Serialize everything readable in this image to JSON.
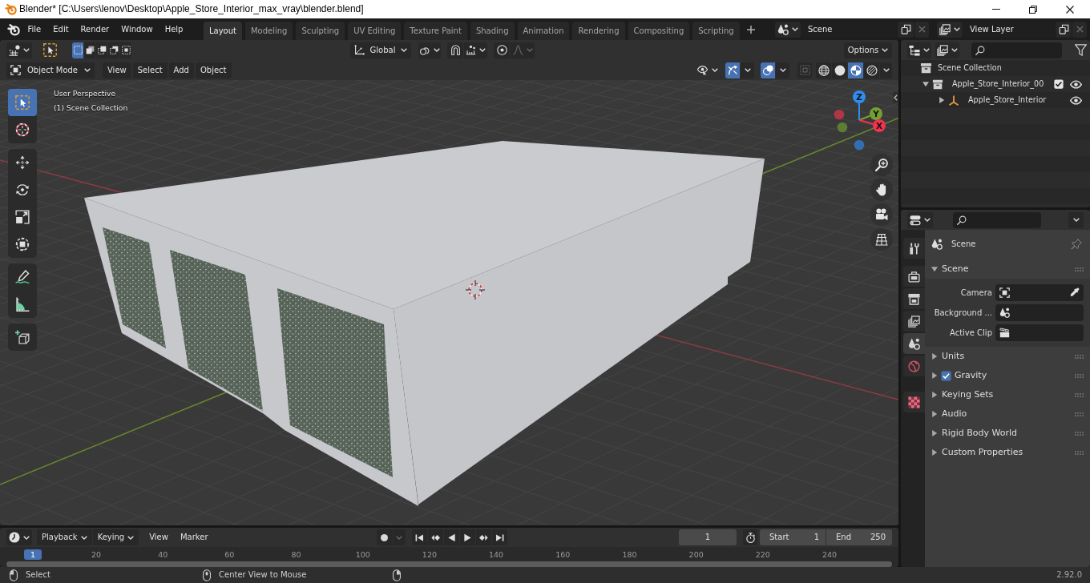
{
  "window": {
    "title": "Blender* [C:\\Users\\lenov\\Desktop\\Apple_Store_Interior_max_vray\\blender.blend]"
  },
  "top_bar": {
    "menus": [
      "File",
      "Edit",
      "Render",
      "Window",
      "Help"
    ],
    "workspaces": [
      {
        "label": "Layout",
        "selected": true
      },
      {
        "label": "Modeling",
        "selected": false
      },
      {
        "label": "Sculpting",
        "selected": false
      },
      {
        "label": "UV Editing",
        "selected": false
      },
      {
        "label": "Texture Paint",
        "selected": false
      },
      {
        "label": "Shading",
        "selected": false
      },
      {
        "label": "Animation",
        "selected": false
      },
      {
        "label": "Rendering",
        "selected": false
      },
      {
        "label": "Compositing",
        "selected": false
      },
      {
        "label": "Scripting",
        "selected": false
      }
    ],
    "scene": "Scene",
    "view_layer": "View Layer"
  },
  "tool_header": {
    "select_modes": [
      {
        "kind": "set",
        "selected": true
      },
      {
        "kind": "extend",
        "selected": false
      },
      {
        "kind": "subtract",
        "selected": false
      },
      {
        "kind": "invert",
        "selected": false
      },
      {
        "kind": "intersect",
        "selected": false
      }
    ],
    "orientation": "Global",
    "snap": {
      "on": false
    },
    "proportional": {
      "on": false
    },
    "options": "Options"
  },
  "viewport_header": {
    "mode": "Object Mode",
    "menus": [
      "View",
      "Select",
      "Add",
      "Object"
    ],
    "gizmos": {
      "on": true
    },
    "overlays": {
      "on": true
    },
    "xray": {
      "on": false
    },
    "shading": [
      {
        "kind": "wireframe",
        "selected": false
      },
      {
        "kind": "solid",
        "selected": false
      },
      {
        "kind": "material",
        "selected": true
      },
      {
        "kind": "rendered",
        "selected": false
      }
    ]
  },
  "viewport": {
    "info": [
      "User Perspective",
      "(1) Scene Collection"
    ],
    "tool_groups": [
      [
        {
          "kind": "select",
          "selected": true
        },
        {
          "kind": "cursor",
          "selected": false
        }
      ],
      [
        {
          "kind": "move",
          "selected": false
        },
        {
          "kind": "rotate",
          "selected": false
        },
        {
          "kind": "scale",
          "selected": false
        },
        {
          "kind": "transform",
          "selected": false
        }
      ],
      [
        {
          "kind": "annotate",
          "selected": false
        },
        {
          "kind": "measure",
          "selected": false
        }
      ],
      [
        {
          "kind": "add",
          "selected": false
        }
      ]
    ],
    "axes": [
      {
        "label": "Z",
        "color": "#2f8cf0"
      },
      {
        "label": "Y",
        "color": "#74a032"
      },
      {
        "label": "X",
        "color": "#f0334e"
      }
    ]
  },
  "timeline": {
    "menus": [
      {
        "label": "Playback",
        "kind": "dropdown"
      },
      {
        "label": "Keying",
        "kind": "dropdown"
      },
      {
        "label": "View",
        "kind": "menu"
      },
      {
        "label": "Marker",
        "kind": "menu"
      }
    ],
    "auto_keying": {
      "on": false
    },
    "current_frame": "1",
    "start_label": "Start",
    "start": "1",
    "end_label": "End",
    "end": "250",
    "playhead": "1",
    "ruler": [
      "20",
      "40",
      "60",
      "80",
      "100",
      "120",
      "140",
      "160",
      "180",
      "200",
      "220",
      "240"
    ]
  },
  "outliner": {
    "root": "Scene Collection",
    "items": [
      {
        "label": "Apple_Store_Interior_00",
        "kind": "collection",
        "expanded": true,
        "checked": true,
        "visible": true,
        "children": [
          {
            "label": "Apple_Store_Interior",
            "kind": "empty",
            "expanded": false,
            "visible": true
          }
        ]
      }
    ]
  },
  "properties": {
    "tab_groups": [
      [
        {
          "kind": "tool",
          "selected": false
        }
      ],
      [
        {
          "kind": "render",
          "selected": false
        },
        {
          "kind": "output",
          "selected": false
        },
        {
          "kind": "view_layer",
          "selected": false
        },
        {
          "kind": "scene",
          "selected": true
        },
        {
          "kind": "world",
          "selected": false
        }
      ],
      [
        {
          "kind": "texture",
          "selected": false
        }
      ]
    ],
    "context": "Scene",
    "panels": [
      {
        "title": "Scene",
        "expanded": true,
        "fields": [
          {
            "label": "Camera",
            "kind": "camera"
          },
          {
            "label": "Background ...",
            "kind": "scene"
          },
          {
            "label": "Active Clip",
            "kind": "clip"
          }
        ]
      },
      {
        "title": "Units",
        "expanded": false
      },
      {
        "title": "Gravity",
        "expanded": false,
        "checked": true
      },
      {
        "title": "Keying Sets",
        "expanded": false
      },
      {
        "title": "Audio",
        "expanded": false
      },
      {
        "title": "Rigid Body World",
        "expanded": false
      },
      {
        "title": "Custom Properties",
        "expanded": false
      }
    ]
  },
  "status_bar": {
    "hints": [
      {
        "kind": "left",
        "label": "Select"
      },
      {
        "kind": "middle",
        "label": "Center View to Mouse"
      },
      {
        "kind": "right"
      }
    ],
    "version": "2.92.0"
  }
}
